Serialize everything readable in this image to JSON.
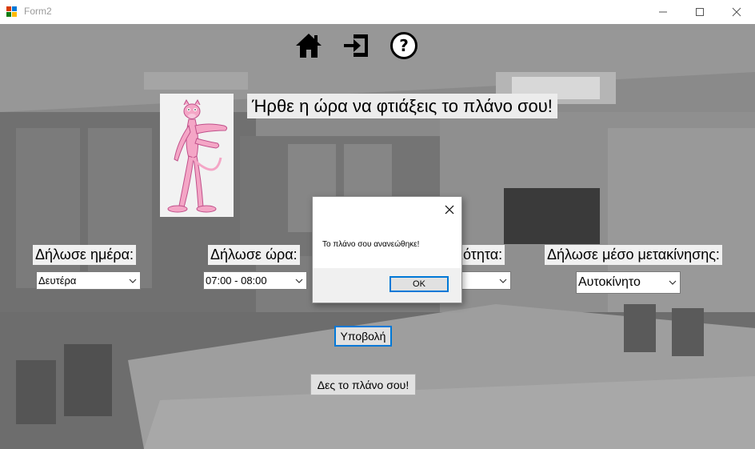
{
  "window": {
    "title": "Form2"
  },
  "toolbar": {
    "icons": [
      "home-icon",
      "sign-in-icon",
      "help-icon"
    ]
  },
  "header": {
    "headline": "Ήρθε η ώρα να φτιάξεις το πλάνο σου!"
  },
  "form": {
    "day_label": "Δήλωσε ημέρα:",
    "day_value": "Δευτέρα",
    "time_label": "Δήλωσε ώρα:",
    "time_value": "07:00 - 08:00",
    "activity_label_partial": "ιότητα:",
    "transport_label": "Δήλωσε μέσο μετακίνησης:",
    "transport_value": "Αυτοκίνητο",
    "submit_label": "Υποβολή",
    "view_plan_label": "Δες το πλάνο σου!"
  },
  "dialog": {
    "message": "Το πλάνο σου ανανεώθηκε!",
    "ok_label": "OK"
  },
  "colors": {
    "focus": "#0078d7",
    "background": "#7d7d7d"
  }
}
